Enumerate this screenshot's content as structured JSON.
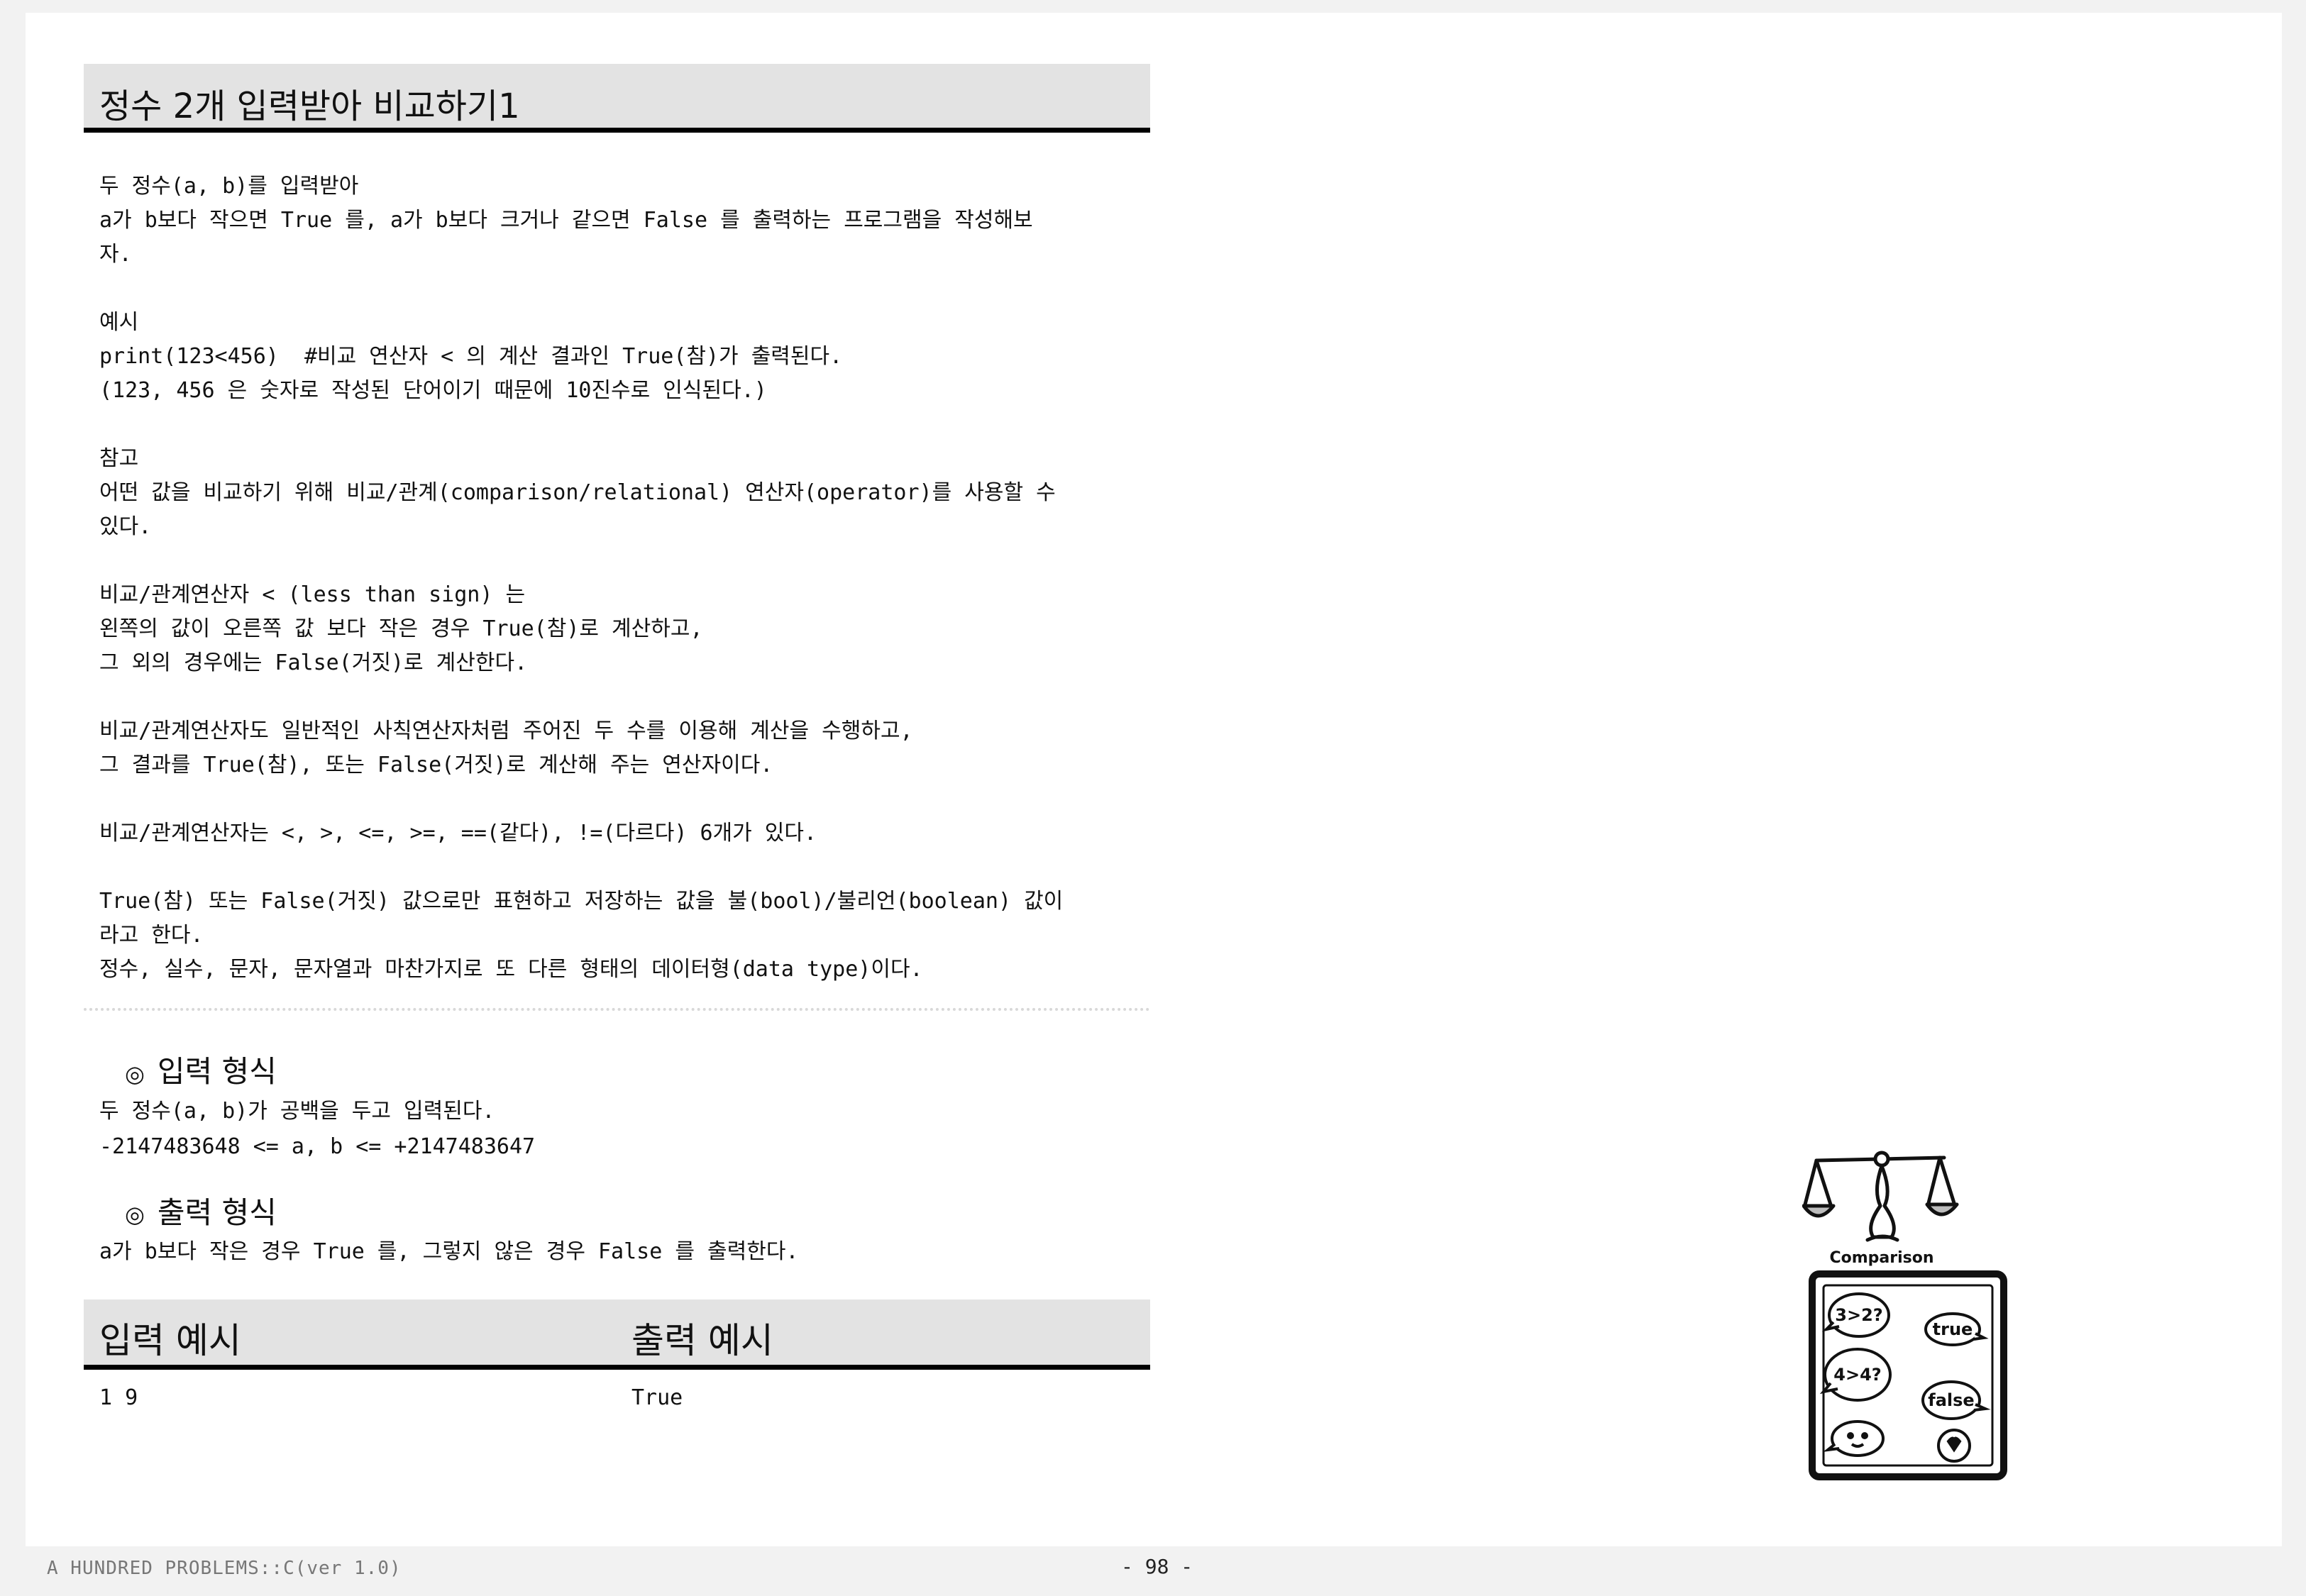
{
  "title": "정수 2개 입력받아 비교하기1",
  "description_lines": [
    "두 정수(a, b)를 입력받아",
    "a가 b보다 작으면 True 를, a가 b보다 크거나 같으면 False 를 출력하는 프로그램을 작성해보",
    "자.",
    "",
    "예시",
    "print(123<456)  #비교 연산자 < 의 계산 결과인 True(참)가 출력된다.",
    "(123, 456 은 숫자로 작성된 단어이기 때문에 10진수로 인식된다.)",
    "",
    "참고",
    "어떤 값을 비교하기 위해 비교/관계(comparison/relational) 연산자(operator)를 사용할 수",
    "있다.",
    "",
    "비교/관계연산자 < (less than sign) 는",
    "왼쪽의 값이 오른쪽 값 보다 작은 경우 True(참)로 계산하고,",
    "그 외의 경우에는 False(거짓)로 계산한다.",
    "",
    "비교/관계연산자도 일반적인 사칙연산자처럼 주어진 두 수를 이용해 계산을 수행하고,",
    "그 결과를 True(참), 또는 False(거짓)로 계산해 주는 연산자이다.",
    "",
    "비교/관계연산자는 <, >, <=, >=, ==(같다), !=(다르다) 6개가 있다.",
    "",
    "True(참) 또는 False(거짓) 값으로만 표현하고 저장하는 값을 불(bool)/불리언(boolean) 값이",
    "라고 한다.",
    "정수, 실수, 문자, 문자열과 마찬가지로 또 다른 형태의 데이터형(data type)이다."
  ],
  "input_section": {
    "marker": "◎",
    "heading": "입력 형식",
    "lines": [
      "두 정수(a, b)가 공백을 두고 입력된다.",
      "-2147483648 <= a, b <= +2147483647"
    ]
  },
  "output_section": {
    "marker": "◎",
    "heading": "출력 형식",
    "lines": [
      "a가 b보다 작은 경우 True 를, 그렇지 않은 경우 False 를 출력한다."
    ]
  },
  "example_table": {
    "input_header": "입력 예시",
    "output_header": "출력 예시",
    "input_value": "1 9",
    "output_value": "True"
  },
  "illustration": {
    "caption": "Comparison",
    "bubbles": [
      "3>2?",
      "true",
      "4>4?",
      "false"
    ]
  },
  "footer": {
    "left": "A HUNDRED PROBLEMS::C(ver 1.0)",
    "page": "- 98 -"
  }
}
